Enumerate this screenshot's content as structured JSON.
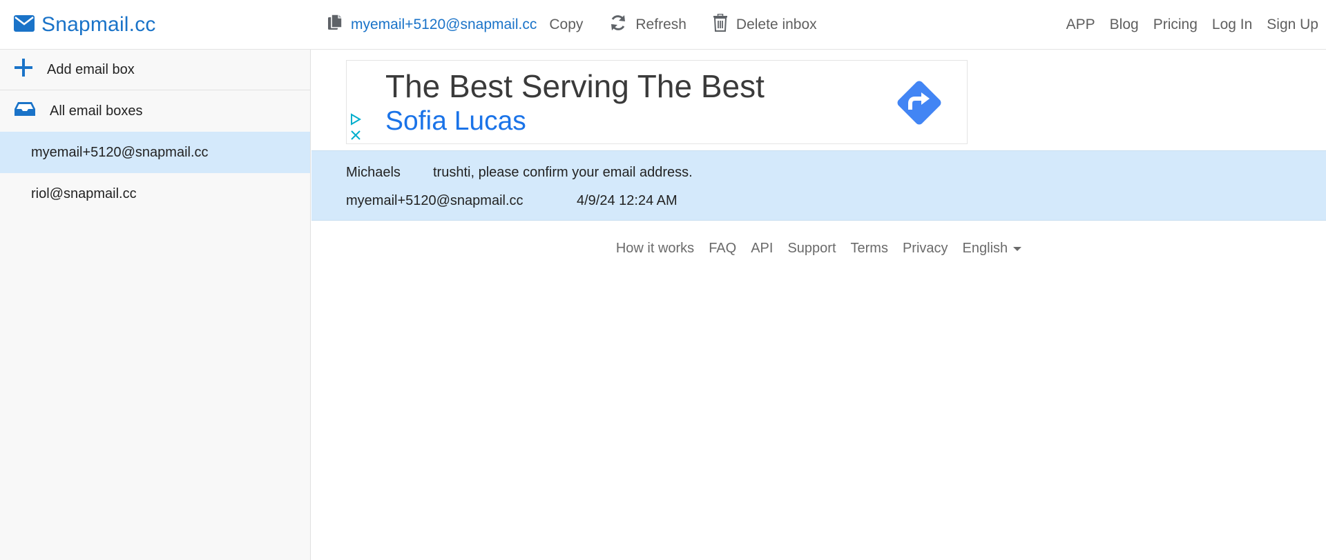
{
  "brand": {
    "name": "Snapmail.cc",
    "icon": "envelope-icon"
  },
  "toolbar": {
    "email": "myemail+5120@snapmail.cc",
    "copy_label": "Copy",
    "refresh_label": "Refresh",
    "delete_label": "Delete inbox",
    "icons": [
      "copy-icon",
      "refresh-icon",
      "trash-icon"
    ]
  },
  "nav": {
    "links": [
      "APP",
      "Blog",
      "Pricing",
      "Log In",
      "Sign Up"
    ]
  },
  "sidebar": {
    "add_label": "Add email box",
    "all_label": "All email boxes",
    "boxes": [
      "myemail+5120@snapmail.cc",
      "riol@snapmail.cc"
    ],
    "active_box": "myemail+5120@snapmail.cc"
  },
  "ad": {
    "headline": "The Best Serving The Best",
    "advertiser": "Sofia Lucas"
  },
  "email": {
    "from": "Michaels",
    "subject": "trushti, please confirm your email address.",
    "to": "myemail+5120@snapmail.cc",
    "date": "4/9/24 12:24 AM"
  },
  "footer": {
    "links": [
      "How it works",
      "FAQ",
      "API",
      "Support",
      "Terms",
      "Privacy"
    ],
    "language": "English"
  },
  "colors": {
    "accent": "#1a73c8",
    "selected_bg": "#d4e9fb",
    "sidebar_bg": "#f8f8f8",
    "muted_text": "#5f5f5f"
  }
}
